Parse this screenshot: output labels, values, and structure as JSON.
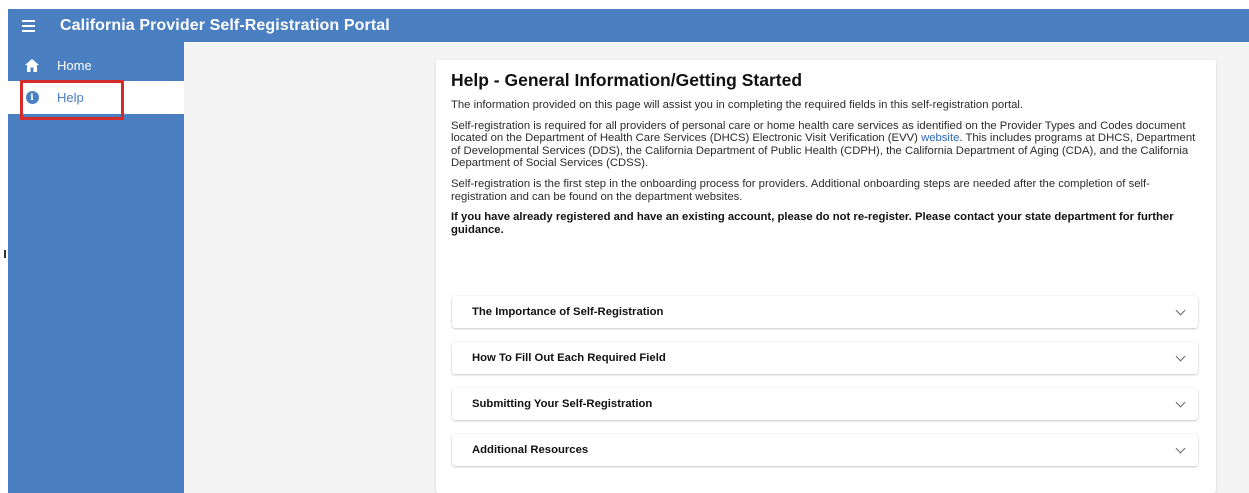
{
  "app": {
    "title": "California Provider Self-Registration Portal"
  },
  "sidebar": {
    "items": [
      {
        "label": "Home",
        "icon": "home-icon"
      },
      {
        "label": "Help",
        "icon": "info-icon",
        "active": true
      }
    ]
  },
  "colors": {
    "primary": "#4a7fc2",
    "highlight": "#d62b2b",
    "link": "#2a67b5"
  },
  "page": {
    "title": "Help - General Information/Getting Started",
    "intro": "The information provided on this page will assist you in completing the required fields in this self-registration portal.",
    "para2_before": "Self-registration is required for all providers of personal care or home health care services as identified on the Provider Types and Codes document located on the Department of Health Care Services (DHCS) Electronic Visit Verification (EVV) ",
    "para2_link": "website",
    "para2_after": ". This includes programs at DHCS, Department of Developmental Services (DDS), the California Department of Public Health (CDPH), the California Department of Aging (CDA), and the California Department of Social Services (CDSS).",
    "para3": "Self-registration is the first step in the onboarding process for providers. Additional onboarding steps are needed after the completion of self-registration and can be found on the department websites.",
    "notice": "If you have already registered and have an existing account, please do not re-register. Please contact your state department for further guidance."
  },
  "accordions": [
    {
      "label": "The Importance of Self-Registration"
    },
    {
      "label": "How To Fill Out Each Required Field"
    },
    {
      "label": "Submitting Your Self-Registration"
    },
    {
      "label": "Additional Resources"
    }
  ]
}
